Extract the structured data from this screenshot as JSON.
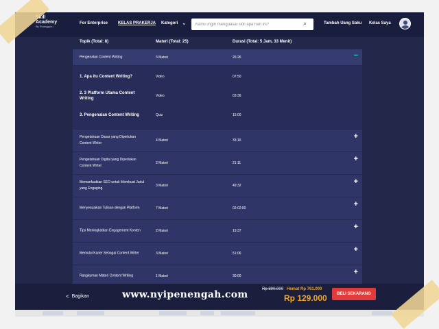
{
  "navbar": {
    "logo_line1": "Skill",
    "logo_line2": "Academy",
    "logo_line3": "By Ruangguru",
    "enterprise": "For Enterprise",
    "prakerja": "KELAS PRAKERJA",
    "kategori": "Kategori",
    "search_placeholder": "Kamu ingin menguasai skill apa hari ini?",
    "uang_saku": "Tambah Uang Saku",
    "kelas_saya": "Kelas Saya"
  },
  "table": {
    "headers": {
      "topik": "Topik (Total: 8)",
      "materi": "Materi (Total: 25)",
      "durasi": "Durasi (Total: 5 Jam, 33 Menit)"
    },
    "expanded": {
      "topic": "Pengenalan Content Writing",
      "materi": "3 Materi",
      "durasi": "26:26",
      "toggle": "−",
      "items": [
        {
          "title": "1. Apa itu Content Writing?",
          "type": "Video",
          "dur": "07:50"
        },
        {
          "title": "2. 3 Platform Utama Content Writing",
          "type": "Video",
          "dur": "03:36"
        },
        {
          "title": "3. Pengenalan Content Writing",
          "type": "Quiz",
          "dur": "15:00"
        }
      ]
    },
    "rows": [
      {
        "topic": "Pengetahuan Dasar yang Diperlukan Content Writer",
        "materi": "4 Materi",
        "durasi": "33:16",
        "toggle": "+"
      },
      {
        "topic": "Pengetahuan Digital yang Diperlukan Content Writer",
        "materi": "2 Materi",
        "durasi": "21:11",
        "toggle": "+"
      },
      {
        "topic": "Memanfaatkan SEO untuk Membuat Judul yang Engaging",
        "materi": "3 Materi",
        "durasi": "49:32",
        "toggle": "+"
      },
      {
        "topic": "Menyesuaikan Tulisan dengan Platform",
        "materi": "7 Materi",
        "durasi": "02:02:00",
        "toggle": "+"
      },
      {
        "topic": "Tips Meningkatkan Engagement Konten",
        "materi": "2 Materi",
        "durasi": "19:37",
        "toggle": "+"
      },
      {
        "topic": "Memulai Karier Sebagai Content Writer",
        "materi": "3 Materi",
        "durasi": "51:06",
        "toggle": "+"
      },
      {
        "topic": "Rangkuman Materi Content Writing",
        "materi": "1 Materi",
        "durasi": "30:00",
        "toggle": "+"
      }
    ]
  },
  "footer": {
    "share": "Bagikan",
    "watermark": "www.nyipenengah.com",
    "original_price": "Rp 890.000",
    "hemat": "Hemat Rp 761.000",
    "price": "Rp 129.000",
    "buy": "BELI SEKARANG"
  },
  "colors": {
    "background": "#23284a",
    "row": "#2f3566",
    "accent_teal": "#28d2c4",
    "price_orange": "#f5a623",
    "buy_red": "#e03c3c"
  }
}
